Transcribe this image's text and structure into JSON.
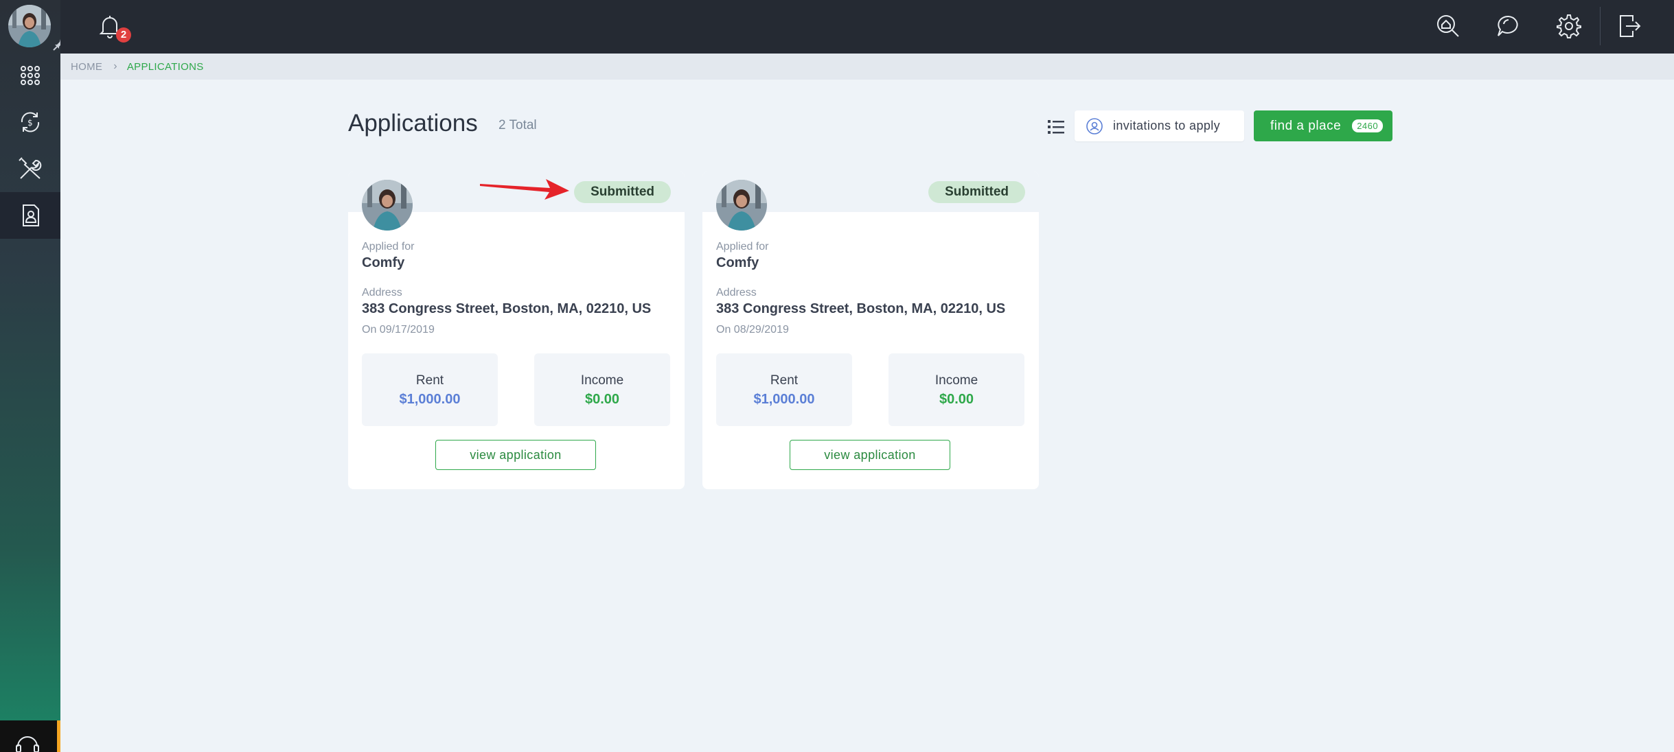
{
  "notifications": {
    "count": "2"
  },
  "breadcrumb": {
    "home": "HOME",
    "current": "APPLICATIONS"
  },
  "page": {
    "title": "Applications",
    "total": "2 Total"
  },
  "actions": {
    "invitations_label": "invitations to apply",
    "find_label": "find a place",
    "find_count": "2460"
  },
  "labels": {
    "applied_for": "Applied for",
    "address": "Address",
    "rent": "Rent",
    "income": "Income",
    "view": "view application"
  },
  "applications": [
    {
      "status": "Submitted",
      "property": "Comfy",
      "address": "383 Congress Street, Boston, MA, 02210, US",
      "date": "On 09/17/2019",
      "rent": "$1,000.00",
      "income": "$0.00"
    },
    {
      "status": "Submitted",
      "property": "Comfy",
      "address": "383 Congress Street, Boston, MA, 02210, US",
      "date": "On 08/29/2019",
      "rent": "$1,000.00",
      "income": "$0.00"
    }
  ],
  "colors": {
    "accent_green": "#2ea84a",
    "status_bg": "#cfe8d4",
    "rent_blue": "#5b7fd6",
    "topbar": "#252a33",
    "badge_red": "#e04040"
  },
  "icons": {
    "sidebar": [
      "apps-grid-icon",
      "money-cycle-icon",
      "tools-icon",
      "applications-doc-icon"
    ],
    "topbar": [
      "search-home-icon",
      "chat-icon",
      "gear-icon",
      "logout-icon"
    ]
  }
}
